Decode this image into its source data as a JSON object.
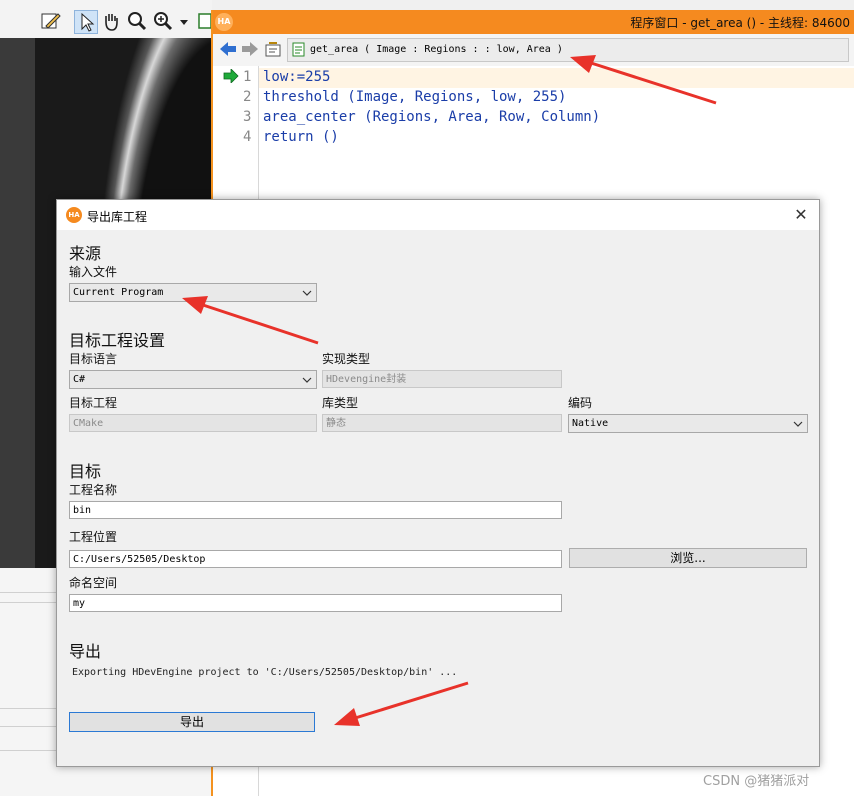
{
  "program_window": {
    "title": "程序窗口 - get_area () - 主线程: 84600",
    "procedure_signature": "get_area ( Image : Regions : : low, Area )",
    "code_lines": [
      {
        "number": "1",
        "text": "low:=255"
      },
      {
        "number": "2",
        "text": "threshold (Image, Regions, low, 255)"
      },
      {
        "number": "3",
        "text": "area_center (Regions, Area, Row, Column)"
      },
      {
        "number": "4",
        "text": "return ()"
      }
    ]
  },
  "dialog": {
    "title": "导出库工程",
    "close_glyph": "✕",
    "source": {
      "heading": "来源",
      "input_file_label": "输入文件",
      "input_file_value": "Current Program"
    },
    "target_settings": {
      "heading": "目标工程设置",
      "language_label": "目标语言",
      "language_value": "C#",
      "impl_type_label": "实现类型",
      "impl_type_value": "HDevengine封装",
      "project_label": "目标工程",
      "project_value": "CMake",
      "lib_type_label": "库类型",
      "lib_type_value": "静态",
      "encoding_label": "编码",
      "encoding_value": "Native"
    },
    "target": {
      "heading": "目标",
      "project_name_label": "工程名称",
      "project_name_value": "bin",
      "location_label": "工程位置",
      "location_value": "C:/Users/52505/Desktop",
      "browse_label": "浏览...",
      "namespace_label": "命名空间",
      "namespace_value": "my"
    },
    "export": {
      "heading": "导出",
      "status": "Exporting HDevEngine project to 'C:/Users/52505/Desktop/bin' ...",
      "button_label": "导出"
    }
  },
  "watermark": "CSDN @猪猪派对",
  "colors": {
    "title_orange": "#f58a1f",
    "code_blue": "#1a3da8",
    "arrow_red": "#e8322a"
  }
}
